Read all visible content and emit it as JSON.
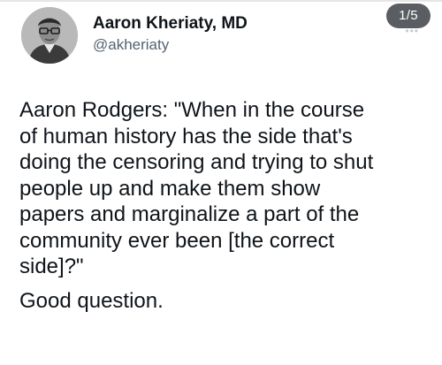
{
  "author": {
    "name": "Aaron Kheriaty, MD",
    "handle": "@akheriaty",
    "avatar_icon": "profile-photo"
  },
  "thread_counter": "1/5",
  "more_icon": "more-dots-icon",
  "tweet": {
    "paragraph_1": "Aaron Rodgers: \"When in the course\nof human history has the side that's\ndoing the censoring and trying to shut\npeople up and make them show\npapers and marginalize a part of the\ncommunity ever been [the correct\nside]?\"",
    "paragraph_2": "Good question."
  },
  "colors": {
    "text": "#0f1419",
    "secondary_text": "#536471",
    "counter_bg": "#5a5e62",
    "background": "#ffffff"
  }
}
